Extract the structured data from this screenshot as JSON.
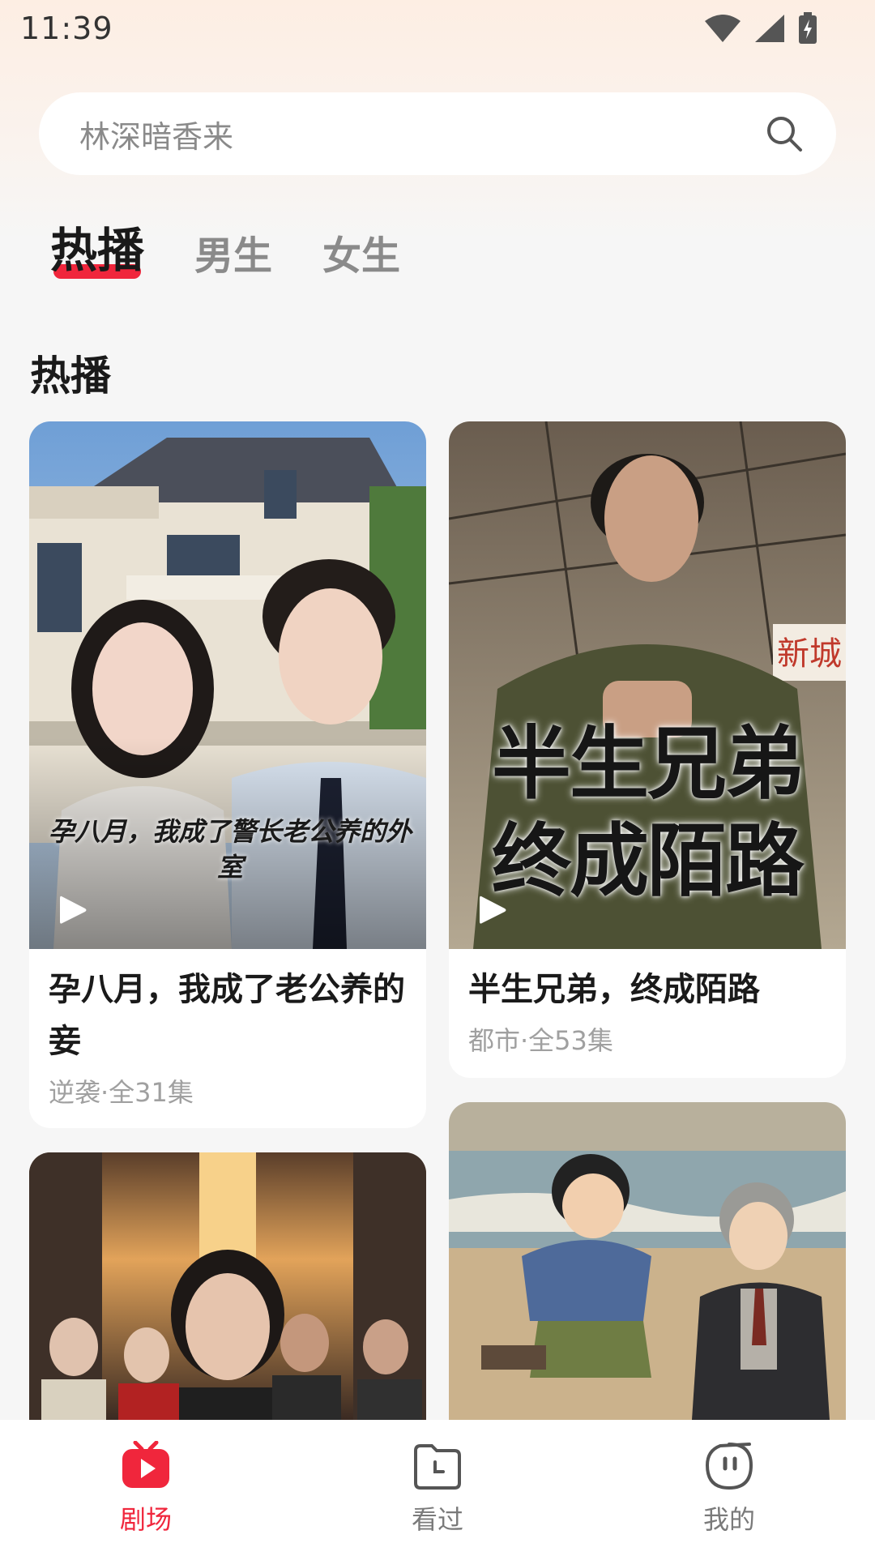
{
  "status_bar": {
    "time": "11:39"
  },
  "search": {
    "placeholder": "林深暗香来"
  },
  "tabs": [
    {
      "label": "热播",
      "active": true
    },
    {
      "label": "男生",
      "active": false
    },
    {
      "label": "女生",
      "active": false
    }
  ],
  "section": {
    "title": "热播"
  },
  "cards": [
    {
      "title": "孕八月，我成了老公养的妾",
      "meta": "逆袭·全31集",
      "poster_text": "孕八月，我成了警长老公养的外室"
    },
    {
      "title": "半生兄弟，终成陌路",
      "meta": "都市·全53集",
      "poster_text_line1": "半生兄弟",
      "poster_text_line2": "终成陌路",
      "sign_text": "新城"
    }
  ],
  "bottom_nav": [
    {
      "label": "剧场",
      "icon": "theater-icon",
      "active": true
    },
    {
      "label": "看过",
      "icon": "history-folder-icon",
      "active": false
    },
    {
      "label": "我的",
      "icon": "profile-icon",
      "active": false
    }
  ],
  "colors": {
    "accent": "#f0263c",
    "background": "#f6f6f6",
    "muted_text": "#a0a0a0"
  }
}
